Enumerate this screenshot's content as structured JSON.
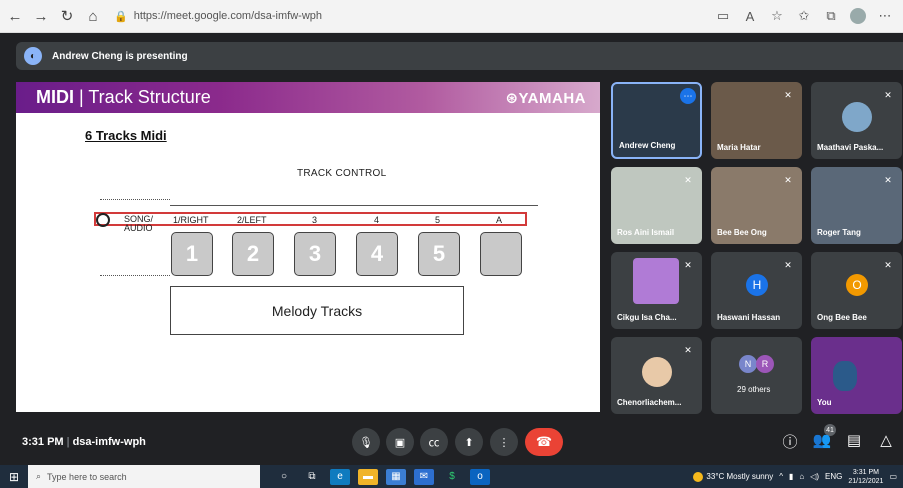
{
  "browser": {
    "url": "https://meet.google.com/dsa-imfw-wph",
    "back": "←",
    "forward": "→",
    "reload": "↻",
    "home": "⌂"
  },
  "presenting": {
    "text": "Andrew Cheng is presenting"
  },
  "slide": {
    "title_bold": "MIDI",
    "title_sep": " | ",
    "title_rest": "Track Structure",
    "brand": "⊛YAMAHA",
    "heading": "6 Tracks Midi",
    "track_control": "TRACK CONTROL",
    "song_label": "SONG/ AUDIO",
    "track_labels": [
      "1/RIGHT",
      "2/LEFT",
      "3",
      "4",
      "5",
      "A"
    ],
    "track_boxes": [
      "1",
      "2",
      "3",
      "4",
      "5",
      ""
    ],
    "melody": "Melody Tracks"
  },
  "participants": [
    {
      "name": "Andrew Cheng",
      "active": true
    },
    {
      "name": "Maria Hatar"
    },
    {
      "name": "Maathavi Paska..."
    },
    {
      "name": "Ros Aini Ismail"
    },
    {
      "name": "Bee Bee Ong"
    },
    {
      "name": "Roger Tang"
    },
    {
      "name": "Cikgu Isa Cha..."
    },
    {
      "name": "Haswani Hassan",
      "letter": "H",
      "color": "#1a73e8"
    },
    {
      "name": "Ong Bee Bee",
      "letter": "O",
      "color": "#f29900"
    },
    {
      "name": "Chenorliachem..."
    },
    {
      "name": "29 others",
      "letters": [
        "N",
        "R"
      ]
    },
    {
      "name": "You"
    }
  ],
  "meet_bar": {
    "time": "3:31 PM",
    "separator": "|",
    "code": "dsa-imfw-wph",
    "participant_count": "41"
  },
  "taskbar": {
    "search_placeholder": "Type here to search",
    "weather": "33°C  Mostly sunny",
    "lang": "ENG",
    "time": "3:31 PM",
    "date": "21/12/2021"
  },
  "colors": {
    "end_call": "#ea4335",
    "accent": "#8ab4f8",
    "highlight": "#d23a3a"
  }
}
